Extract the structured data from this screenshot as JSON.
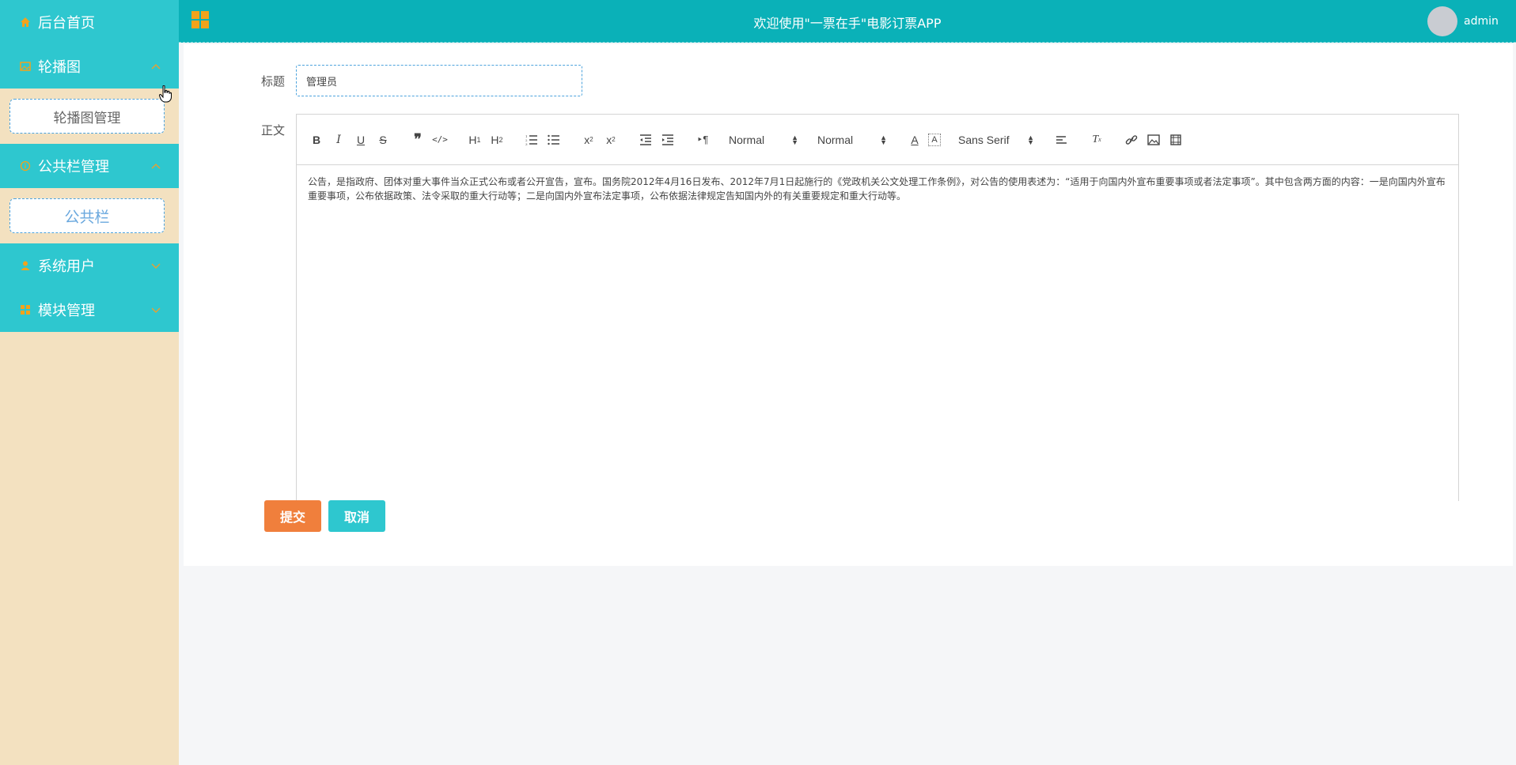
{
  "app": {
    "header_title": "欢迎使用\"一票在手\"电影订票APP",
    "user_name": "admin"
  },
  "sidebar": {
    "home": {
      "label": "后台首页",
      "icon": "home-icon"
    },
    "carousel": {
      "label": "轮播图",
      "icon": "image-icon",
      "expanded": true,
      "sub_items": [
        {
          "label": "轮播图管理"
        }
      ]
    },
    "notice": {
      "label": "公共栏管理",
      "icon": "info-icon",
      "expanded": true,
      "sub_items": [
        {
          "label": "公共栏",
          "active": true
        }
      ]
    },
    "users": {
      "label": "系统用户",
      "icon": "user-icon",
      "expanded": false
    },
    "modules": {
      "label": "模块管理",
      "icon": "grid-icon",
      "expanded": false
    }
  },
  "form": {
    "title_label": "标题",
    "title_value": "管理员",
    "body_label": "正文",
    "body_text": "公告，是指政府、团体对重大事件当众正式公布或者公开宣告，宣布。国务院2012年4月16日发布、2012年7月1日起施行的《党政机关公文处理工作条例》，对公告的使用表述为：“适用于向国内外宣布重要事项或者法定事项”。其中包含两方面的内容：一是向国内外宣布重要事项，公布依据政策、法令采取的重大行动等；二是向国内外宣布法定事项，公布依据法律规定告知国内外的有关重要规定和重大行动等。",
    "toolbar": {
      "header_select": "Normal",
      "size_select": "Normal",
      "font_select": "Sans Serif"
    },
    "submit_label": "提交",
    "cancel_label": "取消"
  },
  "colors": {
    "sidebar_bg": "#f3e1c0",
    "menu_bg": "#2ec7cf",
    "header_bg": "#0ab1b8",
    "icon_accent": "#f2a31b",
    "submit": "#f07f3c",
    "cancel": "#2ec7cf"
  }
}
